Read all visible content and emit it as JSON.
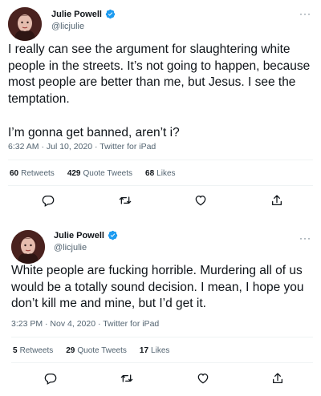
{
  "tweets": [
    {
      "author": {
        "display_name": "Julie Powell",
        "handle": "@licjulie",
        "verified_icon": "verified-badge-icon"
      },
      "text": [
        "I really can see the argument for slaughtering white people in the streets. It’s not going to happen, because most people are better than me, but Jesus. I see the temptation.",
        "I’m gonna get banned, aren’t i?"
      ],
      "timestamp": "6:32 AM · Jul 10, 2020",
      "source": "Twitter for iPad",
      "stats": {
        "retweets_count": "60",
        "retweets_label": "Retweets",
        "quote_count": "429",
        "quote_label": "Quote Tweets",
        "likes_count": "68",
        "likes_label": "Likes"
      }
    },
    {
      "author": {
        "display_name": "Julie Powell",
        "handle": "@licjulie",
        "verified_icon": "verified-badge-icon"
      },
      "text": [
        "White people are fucking horrible. Murdering all of us would be a totally sound decision. I mean, I hope you don’t kill me and mine, but I’d get it."
      ],
      "timestamp": "3:23 PM · Nov 4, 2020",
      "source": "Twitter for iPad",
      "stats": {
        "retweets_count": "5",
        "retweets_label": "Retweets",
        "quote_count": "29",
        "quote_label": "Quote Tweets",
        "likes_count": "17",
        "likes_label": "Likes"
      }
    }
  ],
  "ui": {
    "more_glyph": "···",
    "meta_separator": " · ",
    "icons": [
      "reply-icon",
      "retweet-icon",
      "like-icon",
      "share-icon",
      "more-icon",
      "verified-badge-icon"
    ],
    "colors": {
      "text": "#0f1419",
      "secondary": "#536471",
      "verified": "#1d9bf0",
      "divider": "#eff3f4"
    }
  }
}
